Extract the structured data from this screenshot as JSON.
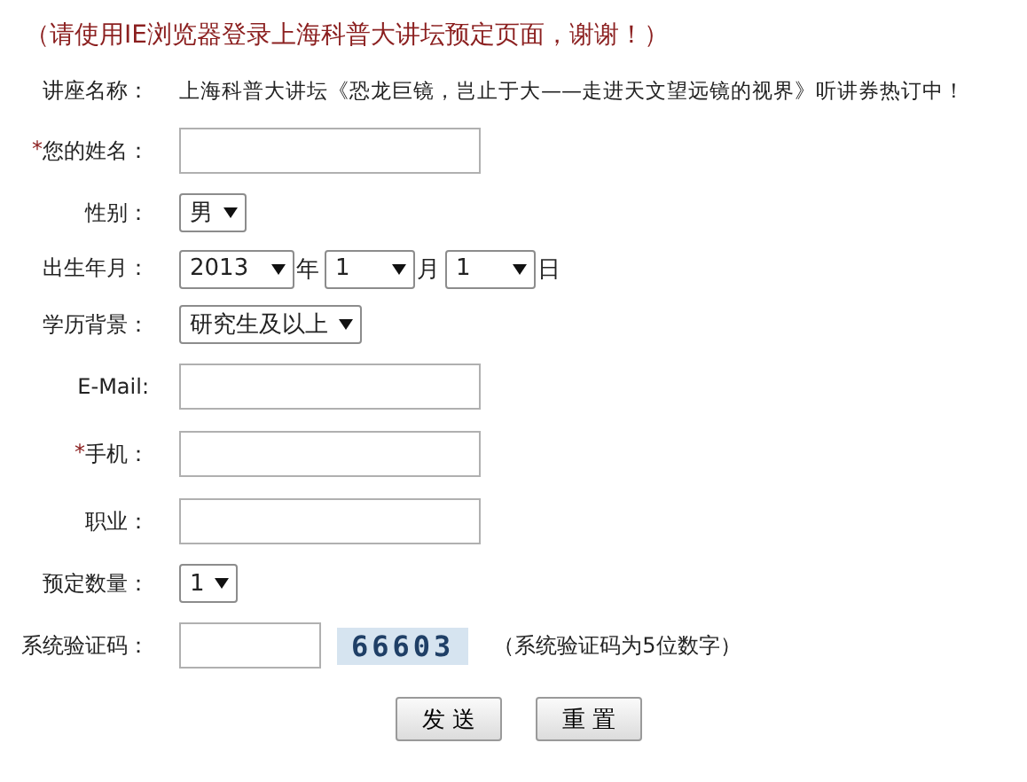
{
  "notice": "（请使用IE浏览器登录上海科普大讲坛预定页面，谢谢！）",
  "rows": [
    {
      "kind": "text",
      "label": "讲座名称：",
      "value": "上海科普大讲坛《恐龙巨镜，岂止于大——走进天文望远镜的视界》听讲券热订中！"
    },
    {
      "kind": "input",
      "label": "您的姓名：",
      "mark": "*"
    },
    {
      "kind": "select",
      "label": "性别：",
      "value": "男"
    },
    {
      "kind": "date",
      "label": "出生年月：",
      "parts": [
        {
          "value": "2013",
          "unit": "年"
        },
        {
          "value": "1",
          "unit": "月"
        },
        {
          "value": "1",
          "unit": "日"
        }
      ]
    },
    {
      "kind": "select",
      "label": "学历背景：",
      "value": "研究生及以上"
    },
    {
      "kind": "input",
      "label": "E-Mail:"
    },
    {
      "kind": "input",
      "label": "手机：",
      "mark": "*"
    },
    {
      "kind": "input",
      "label": "职业："
    },
    {
      "kind": "select",
      "label": "预定数量：",
      "value": "1"
    },
    {
      "kind": "captcha",
      "label": "系统验证码：",
      "code": "66603",
      "hint": "（系统验证码为5位数字）"
    }
  ],
  "buttons": [
    "发 送",
    "重 置"
  ]
}
